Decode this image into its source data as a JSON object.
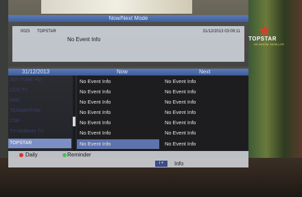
{
  "window": {
    "title": "Now/Next Mode"
  },
  "channel": {
    "number": "0023",
    "name": "TOPSTAR",
    "datetime": "31/12/2013  03:09:11"
  },
  "current_event": "No Event Info",
  "header": {
    "date": "31/12/2013",
    "now": "Now",
    "next": "Next"
  },
  "channels": [
    {
      "name": "JOY TUNE HD"
    },
    {
      "name": "CCN TV"
    },
    {
      "name": "DMC"
    },
    {
      "name": "TESMANTHAI"
    },
    {
      "name": "CSB"
    },
    {
      "name": "TV Maldives TV"
    },
    {
      "name": "TOPSTAR",
      "selected": true
    }
  ],
  "events": [
    {
      "now": "No Event Info",
      "next": "No Event Info"
    },
    {
      "now": "No Event Info",
      "next": "No Event Info"
    },
    {
      "now": "No Event Info",
      "next": "No Event Info"
    },
    {
      "now": "No Event Info",
      "next": "No Event Info"
    },
    {
      "now": "No Event Info",
      "next": "No Event Info"
    },
    {
      "now": "No Event Info",
      "next": "No Event Info"
    },
    {
      "now": "No Event Info",
      "next": "No Event Info",
      "selected": true
    }
  ],
  "footer": {
    "daily": "Daily",
    "reminder": "Reminder",
    "info_key": "i +",
    "info": "Info",
    "daily_color": "#e03030",
    "reminder_color": "#4fc04f"
  },
  "logo": {
    "text": "TOPSTAR",
    "sub": "HD DIGITAL SATELLITE",
    "icon": "star-icon"
  }
}
